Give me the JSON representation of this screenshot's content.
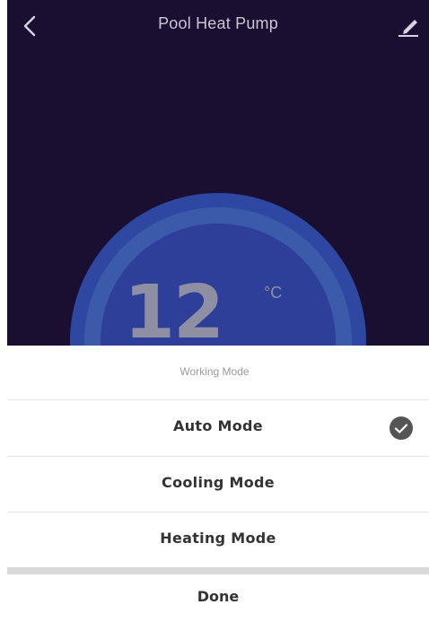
{
  "header": {
    "title": "Pool Heat Pump",
    "back_icon": "chevron-left-icon",
    "edit_icon": "pencil-icon"
  },
  "thermostat": {
    "temperature": "12",
    "unit": "°C"
  },
  "mode_sheet": {
    "title": "Working Mode",
    "options": [
      {
        "label": "Auto Mode",
        "selected": true
      },
      {
        "label": "Cooling Mode",
        "selected": false
      },
      {
        "label": "Heating Mode",
        "selected": false
      }
    ],
    "done_label": "Done"
  },
  "colors": {
    "background": "#1a0f30",
    "dial_outer": "#2e47a0",
    "dial_ring": "#3c5aaa",
    "sheet": "#ffffff",
    "check": "#555555"
  }
}
